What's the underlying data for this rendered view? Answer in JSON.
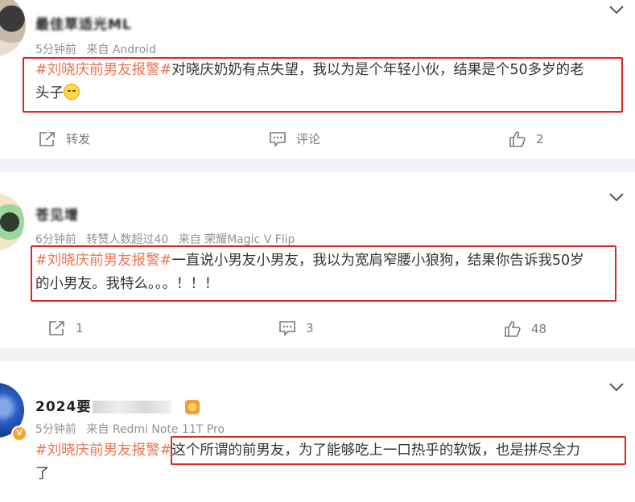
{
  "posts": [
    {
      "name_visible": "最佳草适光ML",
      "time": "5分钟前",
      "source": "来自 Android",
      "hashtag": "#刘晓庆前男友报警#",
      "text_line1": "对晓庆奶奶有点失望，我以为是个年轻小伙，结果是个50多岁的老",
      "text_line2": "头子",
      "actions": {
        "repost_label": "转发",
        "comment_label": "评论",
        "like_count": "2"
      }
    },
    {
      "name_visible": "苍见增",
      "time": "6分钟前",
      "likes_note": "转赞人数超过40",
      "source": "来自 荣耀Magic V Flip",
      "hashtag": "#刘晓庆前男友报警#",
      "text_line1": "一直说小男友小男友，我以为宽肩窄腰小狼狗，结果你告诉我50岁",
      "text_line2": "的小男友。我特么。。。！！！",
      "actions": {
        "repost_count": "1",
        "comment_count": "3",
        "like_count": "48"
      }
    },
    {
      "name_visible": "2024要",
      "time": "5分钟前",
      "source": "来自 Redmi Note 11T Pro",
      "hashtag": "#刘晓庆前男友报警#",
      "text_line1": "这个所谓的前男友，为了能够吃上一口热乎的软饭，也是拼尽全力",
      "text_line2": "了"
    }
  ],
  "colors": {
    "hashtag": "#eb7350",
    "highlight_box": "#e02424",
    "separator": "#f1f2f5",
    "meta": "#939393"
  },
  "icons": [
    "chevron-down-icon",
    "repost-icon",
    "comment-icon",
    "like-icon",
    "emoji-icon",
    "verified-badge-icon"
  ]
}
